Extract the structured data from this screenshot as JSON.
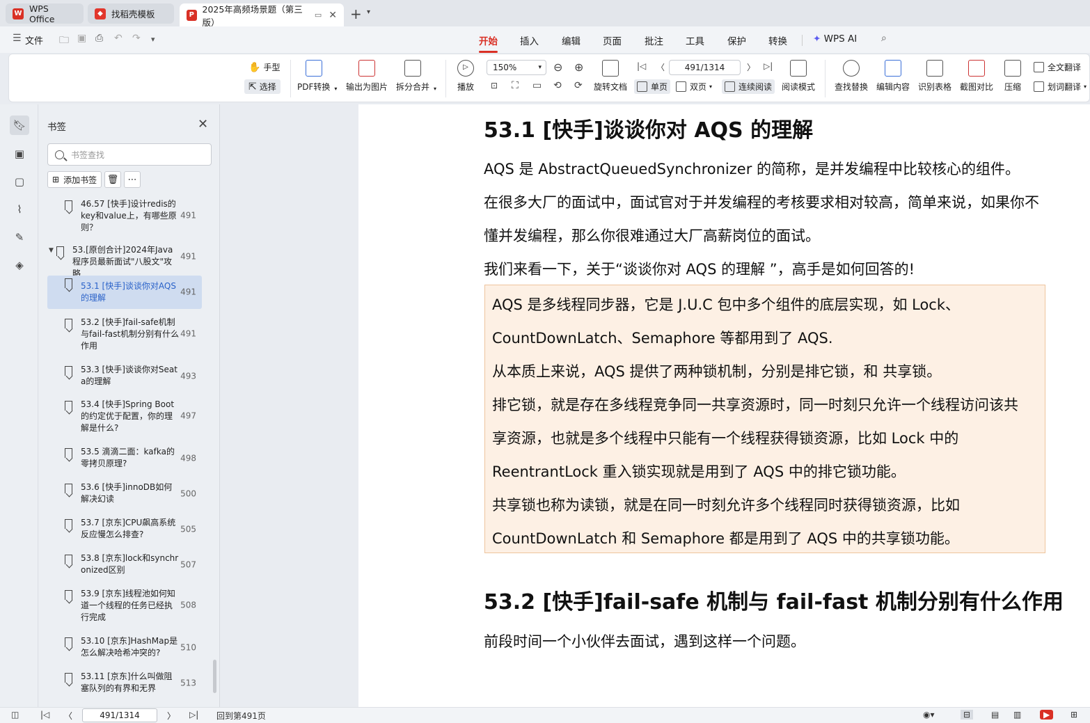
{
  "tabs": [
    {
      "label": "WPS Office",
      "icon": "wps-logo-icon"
    },
    {
      "label": "找稻壳模板",
      "icon": "docer-icon"
    },
    {
      "label": "2025年高频场景题（第三版）",
      "icon": "pdf-icon"
    }
  ],
  "menu": {
    "file": "文件",
    "items": [
      "开始",
      "插入",
      "编辑",
      "页面",
      "批注",
      "工具",
      "保护",
      "转换"
    ],
    "active": "开始",
    "wps_ai": "WPS AI"
  },
  "ribbon": {
    "hand": "手型",
    "select": "选择",
    "pdf_convert": "PDF转换",
    "export_image": "输出为图片",
    "split_merge": "拆分合并",
    "play": "播放",
    "zoom": "150%",
    "rotate": "旋转文档",
    "page_input": "491/1314",
    "single": "单页",
    "double": "双页",
    "continuous": "连续阅读",
    "read_mode": "阅读模式",
    "find_replace": "查找替换",
    "edit_content": "编辑内容",
    "recognize_table": "识别表格",
    "screenshot_compare": "截图对比",
    "compress": "压缩",
    "full_translate": "全文翻译",
    "word_translate": "划词翻译"
  },
  "bookmarks": {
    "title": "书签",
    "search_placeholder": "书签查找",
    "add_label": "添加书签",
    "items": [
      {
        "text": "46.57 [快手]设计redis的key和value上，有哪些原则？",
        "page": "491"
      },
      {
        "text": "53.[原创合计]2024年Java程序员最新面试\"八股文\"攻略",
        "page": "491"
      },
      {
        "text": "53.1 [快手]谈谈你对AQS的理解",
        "page": "491"
      },
      {
        "text": "53.2 [快手]fail-safe机制与fail-fast机制分别有什么作用",
        "page": "491"
      },
      {
        "text": "53.3 [快手]谈谈你对Seata的理解",
        "page": "493"
      },
      {
        "text": "53.4 [快手]Spring Boot的约定优于配置，你的理解是什么?",
        "page": "497"
      },
      {
        "text": "53.5 滴滴二面：kafka的零拷贝原理?",
        "page": "498"
      },
      {
        "text": "53.6 [快手]innoDB如何解决幻读",
        "page": "500"
      },
      {
        "text": "53.7 [京东]CPU飙高系统反应慢怎么排查?",
        "page": "505"
      },
      {
        "text": "53.8 [京东]lock和synchronized区别",
        "page": "507"
      },
      {
        "text": "53.9 [京东]线程池如何知道一个线程的任务已经执行完成",
        "page": "508"
      },
      {
        "text": "53.10 [京东]HashMap是怎么解决哈希冲突的?",
        "page": "510"
      },
      {
        "text": "53.11 [京东]什么叫做阻塞队列的有界和无界",
        "page": "513"
      }
    ]
  },
  "document": {
    "heading1": "53.1 [快手]谈谈你对 AQS 的理解",
    "para1": "AQS 是 AbstractQueuedSynchronizer 的简称，是并发编程中比较核心的组件。",
    "para2a": "在很多大厂的面试中，面试官对于并发编程的考核要求相对较高，简单来说，如果你不",
    "para2b": "懂并发编程，那么你很难通过大厂高薪岗位的面试。",
    "para3": "我们来看一下，关于“谈谈你对 AQS 的理解 ”，高手是如何回答的!",
    "quote": [
      "AQS 是多线程同步器，它是 J.U.C 包中多个组件的底层实现，如 Lock、",
      "CountDownLatch、Semaphore 等都用到了 AQS.",
      "从本质上来说，AQS 提供了两种锁机制，分别是排它锁，和  共享锁。",
      "排它锁，就是存在多线程竞争同一共享资源时，同一时刻只允许一个线程访问该共",
      "享资源，也就是多个线程中只能有一个线程获得锁资源，比如 Lock 中的",
      "ReentrantLock 重入锁实现就是用到了 AQS 中的排它锁功能。",
      "共享锁也称为读锁，就是在同一时刻允许多个线程同时获得锁资源，比如",
      "CountDownLatch 和 Semaphore 都是用到了 AQS 中的共享锁功能。"
    ],
    "heading2": "53.2 [快手]fail-safe 机制与 fail-fast 机制分别有什么作用",
    "para4": "前段时间一个小伙伴去面试，遇到这样一个问题。"
  },
  "status": {
    "page": "491/1314",
    "goto": "回到第491页"
  },
  "colors": {
    "accent": "#d93025",
    "link": "#2a62c9",
    "quote_bg": "#fdf0e4"
  }
}
